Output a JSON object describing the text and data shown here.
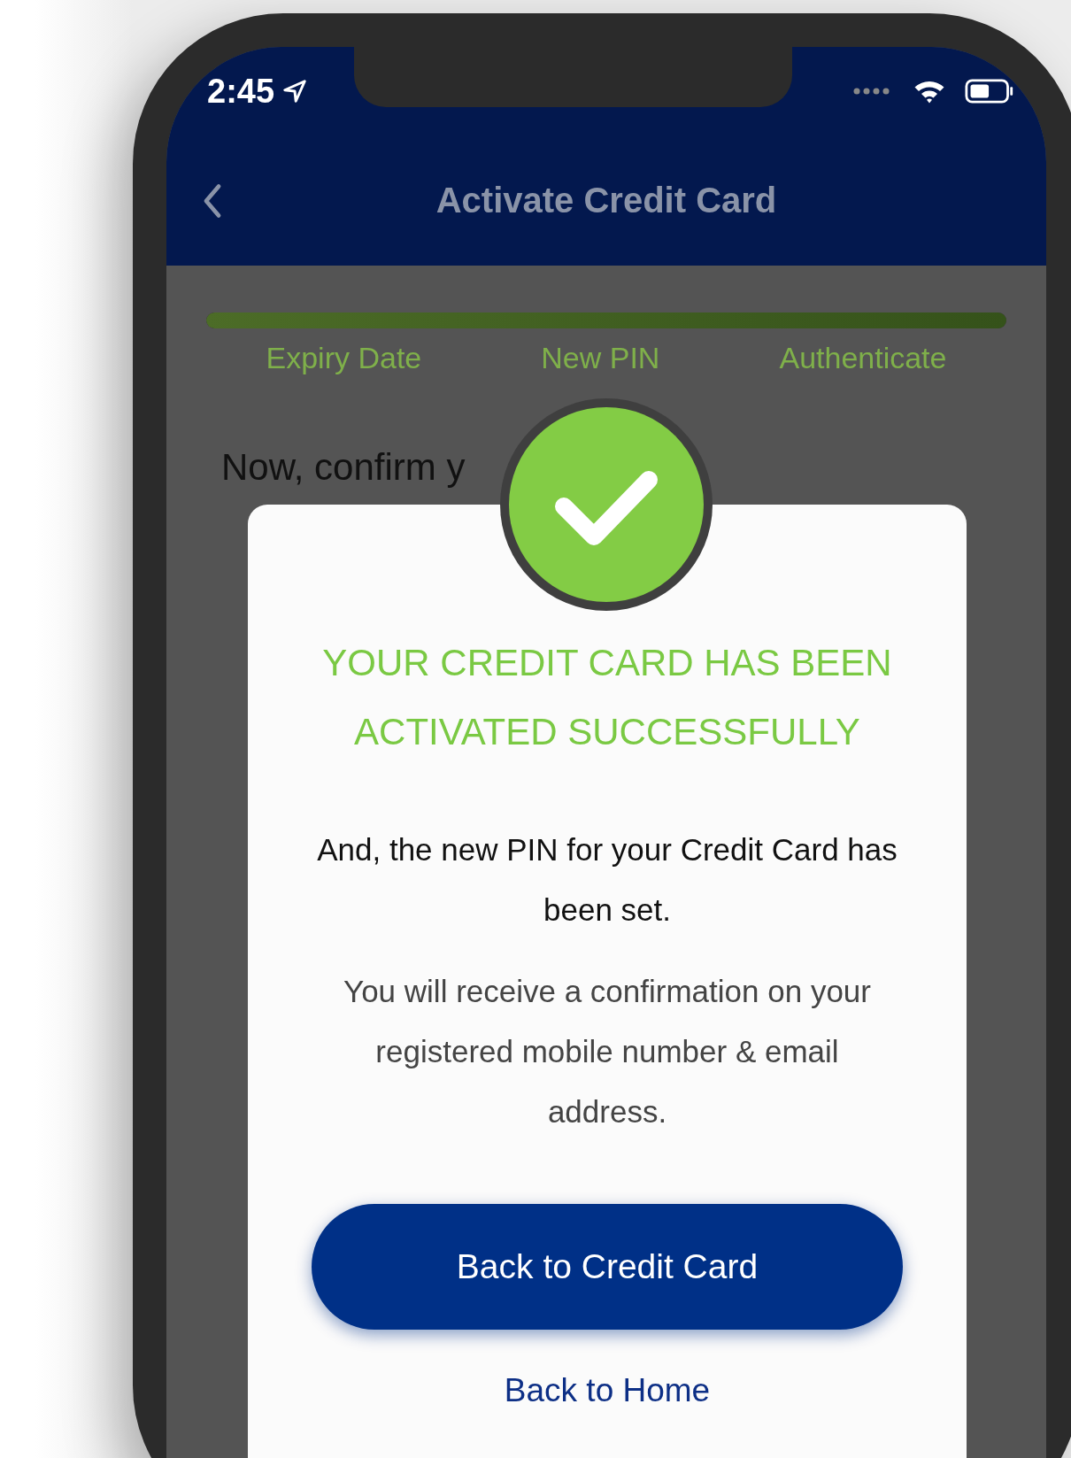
{
  "status_bar": {
    "time": "2:45"
  },
  "nav_bar": {
    "title": "Activate Credit Card"
  },
  "progress": {
    "level": 1,
    "steps": [
      {
        "label": "Expiry Date"
      },
      {
        "label": "New PIN"
      },
      {
        "label": "Authenticate"
      }
    ]
  },
  "background_heading": "Now, confirm y",
  "dialog": {
    "title_lines": [
      "YOUR CREDIT CARD HAS BEEN",
      "ACTIVATED SUCCESSFULLY"
    ],
    "message": "And, the new PIN for your Credit Card has been set.",
    "note": "You will receive a confirmation on your registered mobile number & email address.",
    "primary_button": "Back to Credit Card",
    "link": "Back to Home"
  }
}
